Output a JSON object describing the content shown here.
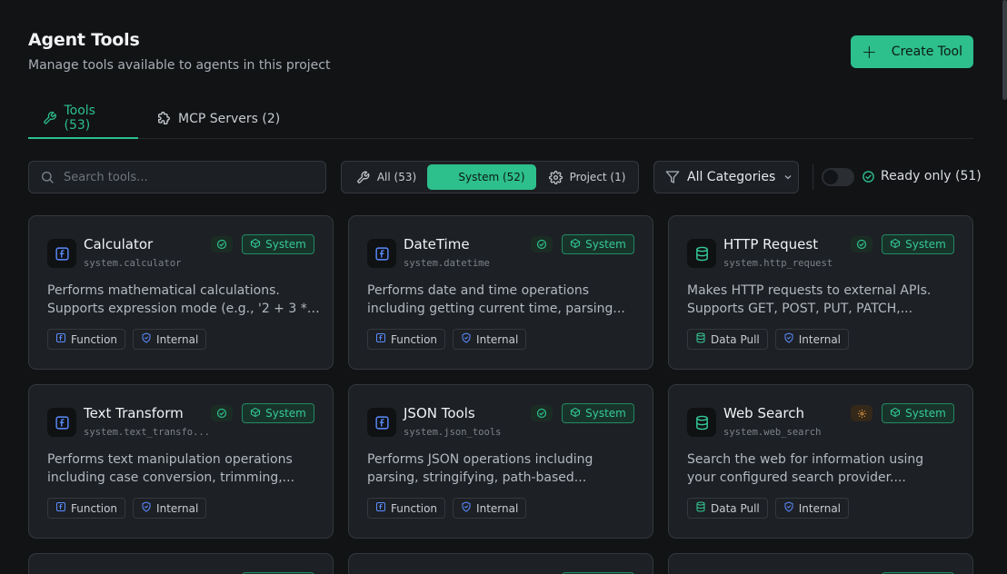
{
  "header": {
    "title": "Agent Tools",
    "subtitle": "Manage tools available to agents in this project",
    "create_button": "Create Tool"
  },
  "tabs": [
    {
      "label": "Tools (53)",
      "active": true,
      "icon": "wrench-icon"
    },
    {
      "label": "MCP Servers (2)",
      "active": false,
      "icon": "puzzle-icon"
    }
  ],
  "search": {
    "placeholder": "Search tools...",
    "value": ""
  },
  "scope_filter": [
    {
      "label": "All (53)",
      "icon": "wrench-icon",
      "active": false
    },
    {
      "label": "System (52)",
      "icon": "box-icon",
      "active": true
    },
    {
      "label": "Project (1)",
      "icon": "gear-icon",
      "active": false
    }
  ],
  "category_select": {
    "value": "All Categories"
  },
  "ready_toggle": {
    "label": "Ready only (51)",
    "on": false
  },
  "colors": {
    "accent": "#2dbf8c",
    "function_tag": "#5b8cff",
    "data_pull": "#35c996",
    "warning": "#d6913a"
  },
  "cards": [
    {
      "name": "Calculator",
      "code": "system.calculator",
      "status": "ok",
      "badge": "System",
      "desc1": "Performs mathematical calculations.",
      "desc2": "Supports expression mode (e.g., '2 + 3 * 4'...",
      "icon": "function-icon",
      "tags": [
        {
          "label": "Function",
          "icon": "function-icon"
        },
        {
          "label": "Internal",
          "icon": "shield-icon"
        }
      ]
    },
    {
      "name": "DateTime",
      "code": "system.datetime",
      "status": "ok",
      "badge": "System",
      "desc1": "Performs date and time operations",
      "desc2": "including getting current time, parsing...",
      "icon": "function-icon",
      "tags": [
        {
          "label": "Function",
          "icon": "function-icon"
        },
        {
          "label": "Internal",
          "icon": "shield-icon"
        }
      ]
    },
    {
      "name": "HTTP Request",
      "code": "system.http_request",
      "status": "ok",
      "badge": "System",
      "desc1": "Makes HTTP requests to external APIs.",
      "desc2": "Supports GET, POST, PUT, PATCH,...",
      "icon": "database-icon",
      "tags": [
        {
          "label": "Data Pull",
          "icon": "database-icon"
        },
        {
          "label": "Internal",
          "icon": "shield-icon"
        }
      ]
    },
    {
      "name": "Text Transform",
      "code": "system.text_transfo...",
      "status": "ok",
      "badge": "System",
      "desc1": "Performs text manipulation operations",
      "desc2": "including case conversion, trimming,...",
      "icon": "function-icon",
      "tags": [
        {
          "label": "Function",
          "icon": "function-icon"
        },
        {
          "label": "Internal",
          "icon": "shield-icon"
        }
      ]
    },
    {
      "name": "JSON Tools",
      "code": "system.json_tools",
      "status": "ok",
      "badge": "System",
      "desc1": "Performs JSON operations including",
      "desc2": "parsing, stringifying, path-based...",
      "icon": "function-icon",
      "tags": [
        {
          "label": "Function",
          "icon": "function-icon"
        },
        {
          "label": "Internal",
          "icon": "shield-icon"
        }
      ]
    },
    {
      "name": "Web Search",
      "code": "system.web_search",
      "status": "warn",
      "badge": "System",
      "desc1": "Search the web for information using",
      "desc2": "your configured search provider....",
      "icon": "database-icon",
      "tags": [
        {
          "label": "Data Pull",
          "icon": "database-icon"
        },
        {
          "label": "Internal",
          "icon": "shield-icon"
        }
      ]
    }
  ]
}
